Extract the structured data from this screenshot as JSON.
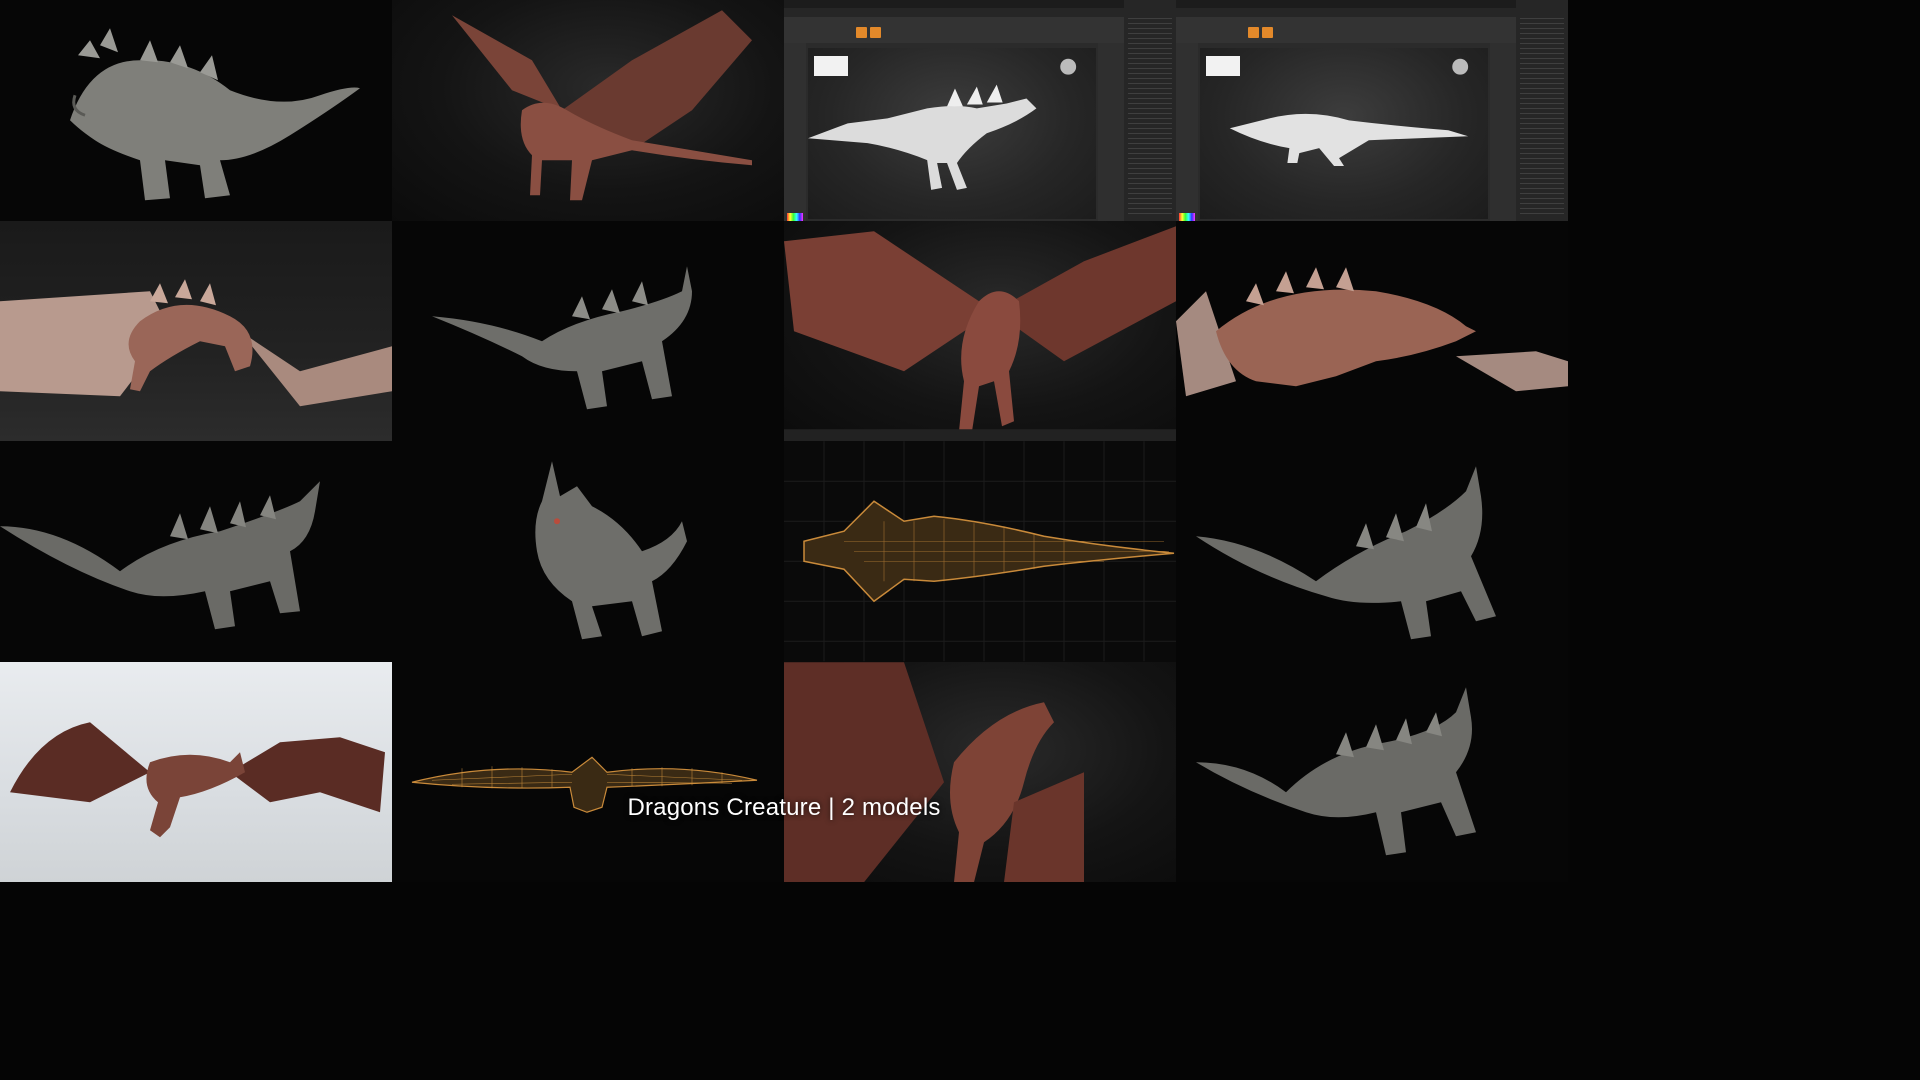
{
  "caption": "Dragons Creature | 2 models",
  "colors": {
    "background": "#050505",
    "grey_dragon": "#8a8a85",
    "red_dragon": "#7a4438",
    "wireframe": "#c98a3a",
    "zbrush_accent": "#e3892a",
    "caption_text": "#ffffff"
  },
  "tiles": [
    {
      "subject": "grey-horned-dragon",
      "background": "black"
    },
    {
      "subject": "red-winged-dragon",
      "background": "studio"
    },
    {
      "subject": "zbrush-sculpt-grey-dragon",
      "background": "zbrush-ui"
    },
    {
      "subject": "zbrush-sculpt-grey-dragon-side",
      "background": "zbrush-ui"
    },
    {
      "subject": "red-dragon-wings-spread",
      "background": "floor"
    },
    {
      "subject": "grey-horned-dragon",
      "background": "black"
    },
    {
      "subject": "red-winged-dragon-front",
      "background": "studio"
    },
    {
      "subject": "red-dragon-crouching",
      "background": "black"
    },
    {
      "subject": "grey-horned-dragon-side",
      "background": "black"
    },
    {
      "subject": "grey-horned-dragon-front",
      "background": "black"
    },
    {
      "subject": "wireframe-dragon-top",
      "background": "grid"
    },
    {
      "subject": "grey-horned-dragon",
      "background": "black"
    },
    {
      "subject": "red-dragon-flying",
      "background": "sky"
    },
    {
      "subject": "wireframe-dragon-wings",
      "background": "black"
    },
    {
      "subject": "red-dragon-closeup",
      "background": "studio"
    },
    {
      "subject": "grey-horned-dragon",
      "background": "black"
    }
  ]
}
